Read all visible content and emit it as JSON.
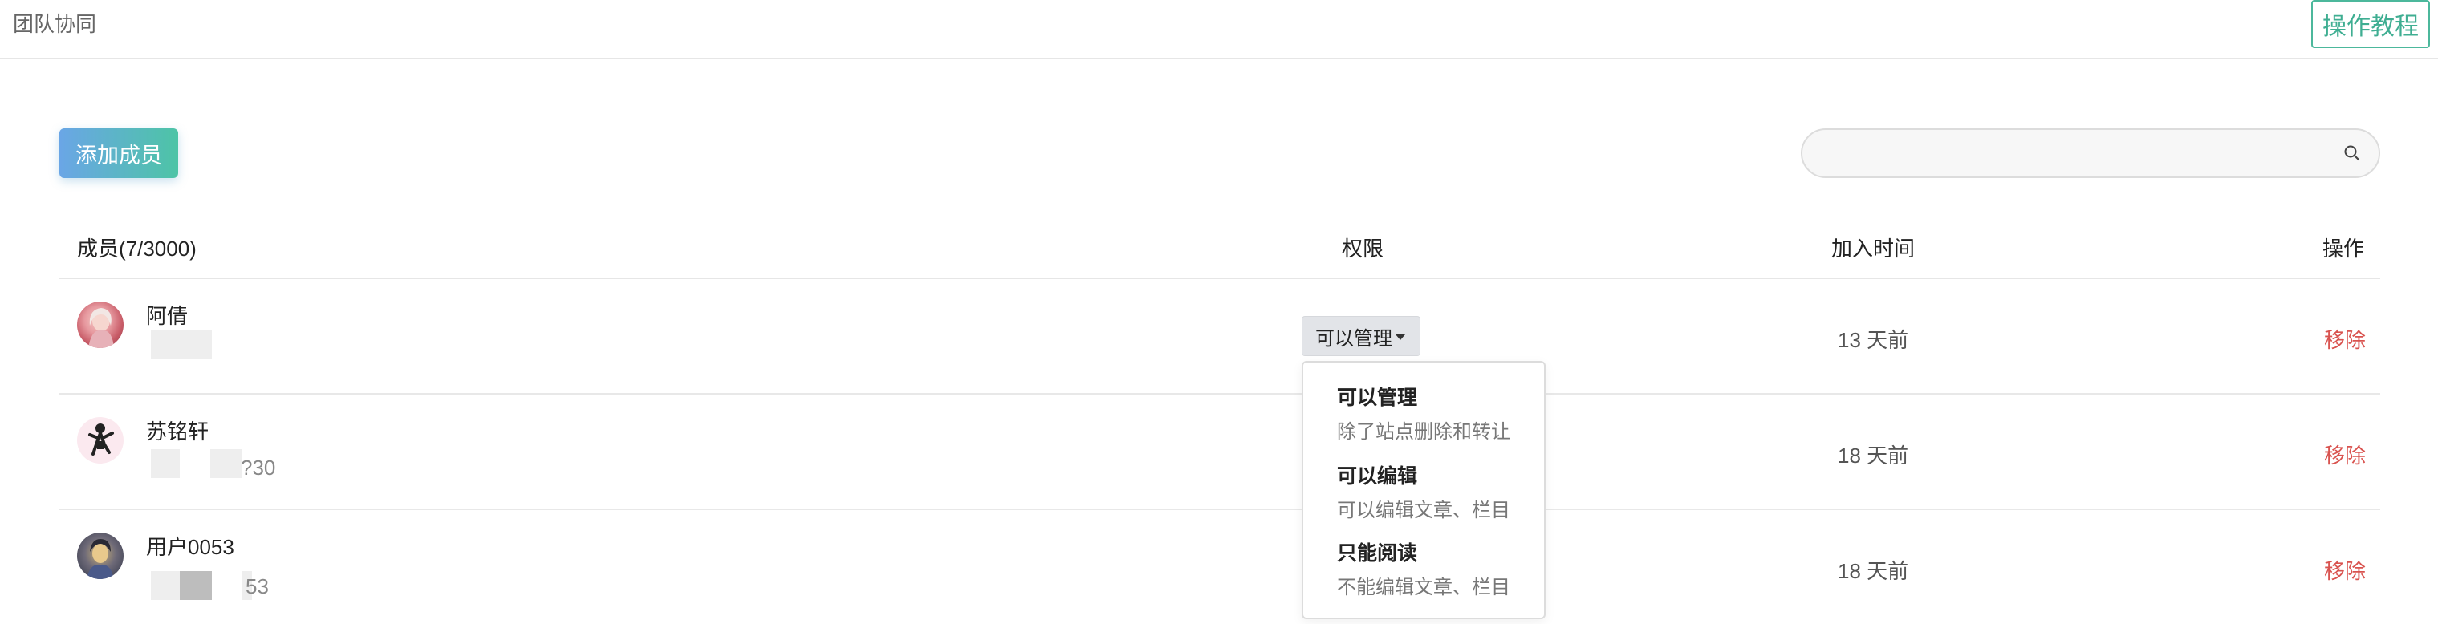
{
  "header": {
    "title": "团队协同",
    "tutorial_label": "操作教程"
  },
  "toolbar": {
    "add_member_label": "添加成员",
    "search_placeholder": ""
  },
  "table": {
    "columns": {
      "member": "成员(7/3000)",
      "permission": "权限",
      "joined": "加入时间",
      "action": "操作"
    },
    "rows": [
      {
        "name": "阿倩",
        "phone_tail": "",
        "permission": "可以管理",
        "joined": "13 天前",
        "action": "移除"
      },
      {
        "name": "苏铭轩",
        "phone_tail": "?30",
        "joined": "18 天前",
        "action": "移除"
      },
      {
        "name": "用户0053",
        "phone_tail": "53",
        "joined": "18 天前",
        "action": "移除"
      }
    ]
  },
  "permission_menu": {
    "items": [
      {
        "title": "可以管理",
        "desc": "除了站点删除和转让"
      },
      {
        "title": "可以编辑",
        "desc": "可以编辑文章、栏目"
      },
      {
        "title": "只能阅读",
        "desc": "不能编辑文章、栏目"
      }
    ]
  },
  "colors": {
    "accent_green": "#3fae92",
    "gradient_start": "#6aa6e6",
    "gradient_end": "#4dc4a6",
    "danger": "#d9534f"
  },
  "icons": [
    "search-icon",
    "caret-down-icon",
    "avatar"
  ]
}
